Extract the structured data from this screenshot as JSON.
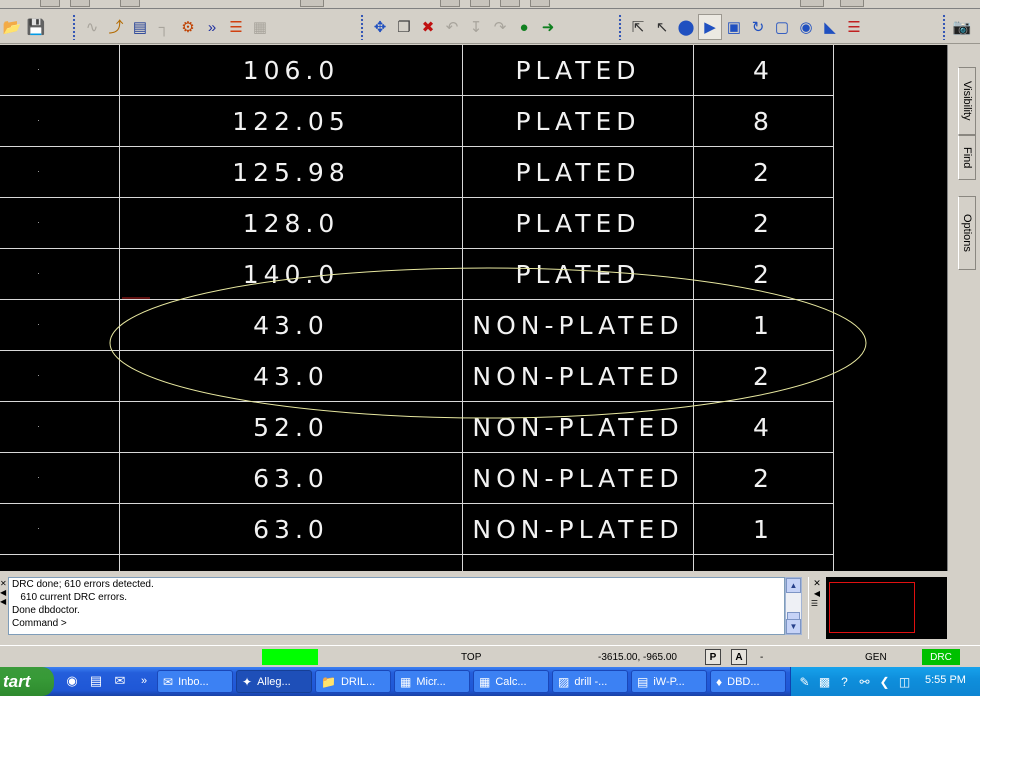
{
  "canvas": {
    "background": "#000000",
    "table_line_color": "#d8d8d8",
    "ellipse_color": "#e8e8a0",
    "rows": [
      {
        "size": "106.0",
        "plating": "PLATED",
        "qty": "4"
      },
      {
        "size": "122.05",
        "plating": "PLATED",
        "qty": "8"
      },
      {
        "size": "125.98",
        "plating": "PLATED",
        "qty": "2"
      },
      {
        "size": "128.0",
        "plating": "PLATED",
        "qty": "2"
      },
      {
        "size": "140.0",
        "plating": "PLATED",
        "qty": "2"
      },
      {
        "size": "43.0",
        "plating": "NON-PLATED",
        "qty": "1"
      },
      {
        "size": "43.0",
        "plating": "NON-PLATED",
        "qty": "2"
      },
      {
        "size": "52.0",
        "plating": "NON-PLATED",
        "qty": "4"
      },
      {
        "size": "63.0",
        "plating": "NON-PLATED",
        "qty": "2"
      },
      {
        "size": "63.0",
        "plating": "NON-PLATED",
        "qty": "1"
      }
    ]
  },
  "side_tabs": [
    "Visibility",
    "Find",
    "Options"
  ],
  "console": {
    "lines": [
      "DRC done; 610 errors detected.",
      "   610 current DRC errors.",
      "Done dbdoctor.",
      "Command >"
    ]
  },
  "status": {
    "active_layer": "TOP",
    "coordinates": "-3615.00, -965.00",
    "key_p": "P",
    "key_a": "A",
    "dash": "-",
    "mode": "GEN",
    "drc": "DRC",
    "indicator_color": "#00ff00"
  },
  "taskbar": {
    "start_label": "tart",
    "overflow": "»",
    "tasks": [
      {
        "label": "Inbo...",
        "icon": "mail-icon"
      },
      {
        "label": "Alleg...",
        "icon": "allegro-icon",
        "active": true
      },
      {
        "label": "DRIL...",
        "icon": "folder-icon"
      },
      {
        "label": "Micr...",
        "icon": "excel-icon"
      },
      {
        "label": "Calc...",
        "icon": "calc-icon"
      },
      {
        "label": "drill -...",
        "icon": "paint-icon"
      },
      {
        "label": "iW-P...",
        "icon": "notepad-icon"
      },
      {
        "label": "DBD...",
        "icon": "pdf-icon"
      }
    ],
    "clock": "5:55 PM"
  }
}
